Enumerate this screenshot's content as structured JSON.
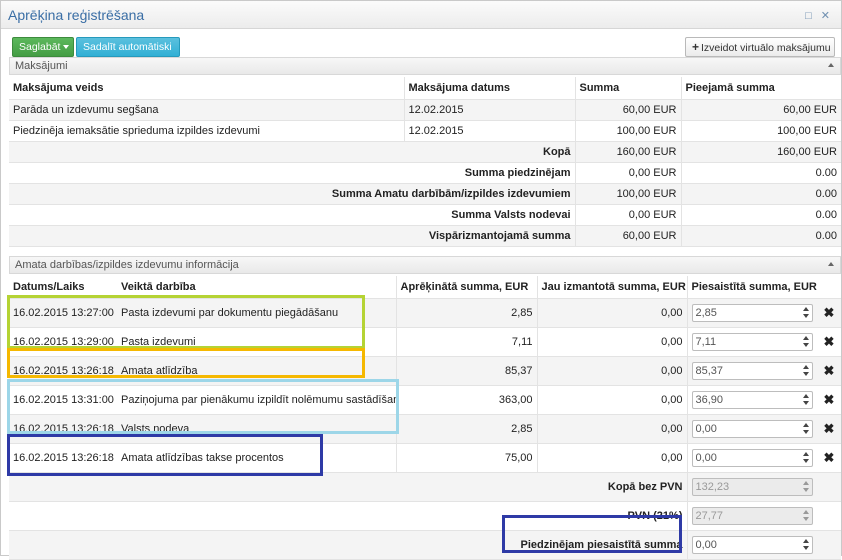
{
  "window": {
    "title": "Aprēķina reģistrēšana",
    "controls": "□ ✕"
  },
  "toolbar": {
    "save_label": "Saglabāt",
    "auto_split_label": "Sadalīt automātiski",
    "virtual_payment_label": "Izveidot virtuālo maksājumu"
  },
  "payments": {
    "section_title": "Maksājumi",
    "columns": [
      "Maksājuma veids",
      "Maksājuma datums",
      "Summa",
      "Pieejamā summa"
    ],
    "rows": [
      {
        "type": "Parāda un izdevumu segšana",
        "date": "12.02.2015",
        "amount": "60,00 EUR",
        "available": "60,00 EUR"
      },
      {
        "type": "Piedzinēja iemaksātie sprieduma izpildes izdevumi",
        "date": "12.02.2015",
        "amount": "100,00 EUR",
        "available": "100,00 EUR"
      }
    ],
    "summary": [
      {
        "label": "Kopā",
        "amount": "160,00 EUR",
        "available": "160,00 EUR"
      },
      {
        "label": "Summa piedzinējam",
        "amount": "0,00 EUR",
        "available": "0.00"
      },
      {
        "label": "Summa Amatu darbībām/izpildes izdevumiem",
        "amount": "100,00 EUR",
        "available": "0.00"
      },
      {
        "label": "Summa Valsts nodevai",
        "amount": "0,00 EUR",
        "available": "0.00"
      },
      {
        "label": "Vispārizmantojamā summa",
        "amount": "60,00 EUR",
        "available": "0.00"
      }
    ]
  },
  "activities": {
    "section_title": "Amata darbības/izpildes izdevumu informācija",
    "columns": [
      "Datums/Laiks",
      "Veiktā darbība",
      "Aprēķinātā summa, EUR",
      "Jau izmantotā summa, EUR",
      "Piesaistītā summa, EUR"
    ],
    "rows": [
      {
        "datetime": "16.02.2015 13:27:00",
        "action": "Pasta izdevumi par dokumentu piegādāšanu",
        "calculated": "2,85",
        "used": "0,00",
        "assigned": "2,85"
      },
      {
        "datetime": "16.02.2015 13:29:00",
        "action": "Pasta izdevumi",
        "calculated": "7,11",
        "used": "0,00",
        "assigned": "7,11"
      },
      {
        "datetime": "16.02.2015 13:26:18",
        "action": "Amata atlīdzība",
        "calculated": "85,37",
        "used": "0,00",
        "assigned": "85,37"
      },
      {
        "datetime": "16.02.2015 13:31:00",
        "action": "Paziņojuma par pienākumu izpildīt nolēmumu sastādīšana",
        "calculated": "363,00",
        "used": "0,00",
        "assigned": "36,90"
      },
      {
        "datetime": "16.02.2015 13:26:18",
        "action": "Valsts nodeva",
        "calculated": "2,85",
        "used": "0,00",
        "assigned": "0,00"
      },
      {
        "datetime": "16.02.2015 13:26:18",
        "action": "Amata atlīdzības takse procentos",
        "calculated": "75,00",
        "used": "0,00",
        "assigned": "0,00"
      }
    ],
    "totals": [
      {
        "label": "Kopā bez PVN",
        "value": "132,23"
      },
      {
        "label": "PVN (21%)",
        "value": "27,77"
      },
      {
        "label": "Piedzinējam piesaistītā summa",
        "value": "0,00"
      }
    ]
  },
  "colors": {
    "highlight_green": "#b5d334",
    "highlight_orange": "#f5b800",
    "highlight_lightblue": "#9dd6e8",
    "highlight_navy": "#2e3aa6"
  },
  "icons": {
    "remove": "✖"
  }
}
